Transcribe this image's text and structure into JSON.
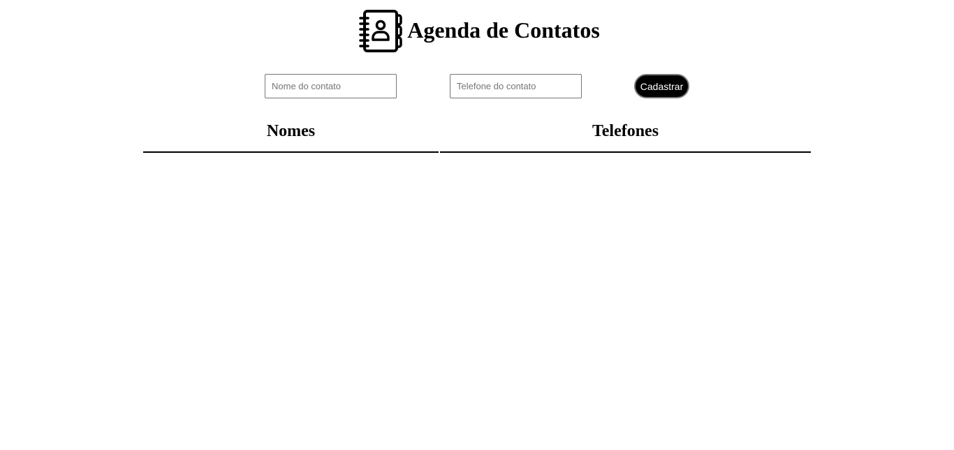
{
  "header": {
    "title": "Agenda de Contatos",
    "logo_icon": "contact-book-icon"
  },
  "form": {
    "name_placeholder": "Nome do contato",
    "name_value": "",
    "phone_placeholder": "Telefone do contato",
    "phone_value": "",
    "submit_label": "Cadastrar"
  },
  "table": {
    "columns": [
      "Nomes",
      "Telefones"
    ],
    "rows": []
  },
  "colors": {
    "background": "#ffffff",
    "text": "#000000",
    "button_bg": "#000000",
    "button_text": "#ffffff"
  }
}
